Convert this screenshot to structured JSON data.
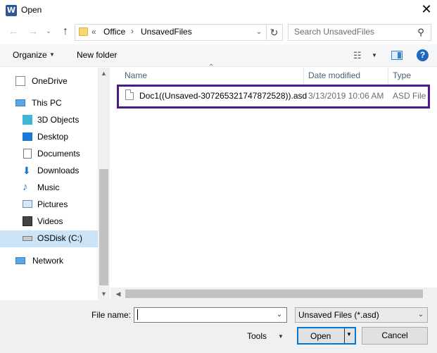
{
  "window": {
    "title": "Open",
    "app_icon_letter": "W",
    "close_glyph": "✕"
  },
  "address": {
    "more_glyph": "«",
    "crumbs": [
      "Office",
      "UnsavedFiles"
    ],
    "separator": "›"
  },
  "search": {
    "placeholder": "Search UnsavedFiles"
  },
  "toolbar": {
    "organize_label": "Organize",
    "new_folder_label": "New folder",
    "help_label": "?"
  },
  "nav": {
    "items": [
      {
        "label": "OneDrive",
        "icon": "onedrive-icon"
      },
      {
        "label": "This PC",
        "icon": "this-pc-icon"
      },
      {
        "label": "3D Objects",
        "icon": "3d-objects-icon"
      },
      {
        "label": "Desktop",
        "icon": "desktop-icon"
      },
      {
        "label": "Documents",
        "icon": "documents-icon"
      },
      {
        "label": "Downloads",
        "icon": "downloads-icon"
      },
      {
        "label": "Music",
        "icon": "music-icon"
      },
      {
        "label": "Pictures",
        "icon": "pictures-icon"
      },
      {
        "label": "Videos",
        "icon": "videos-icon"
      },
      {
        "label": "OSDisk (C:)",
        "icon": "drive-icon"
      },
      {
        "label": "Network",
        "icon": "network-icon"
      }
    ],
    "selected": "OSDisk (C:)"
  },
  "filelist": {
    "columns": [
      "Name",
      "Date modified",
      "Type"
    ],
    "rows": [
      {
        "name": "Doc1((Unsaved-307265321747872528)).asd",
        "date": "3/13/2019 10:06 AM",
        "type": "ASD File"
      }
    ]
  },
  "bottom": {
    "filename_label": "File name:",
    "filename_value": "",
    "filetype_value": "Unsaved Files (*.asd)",
    "tools_label": "Tools",
    "open_label": "Open",
    "cancel_label": "Cancel"
  },
  "colors": {
    "highlight_border": "#4b1a87",
    "selected_nav": "#cce4f7",
    "accent": "#0078d7"
  }
}
